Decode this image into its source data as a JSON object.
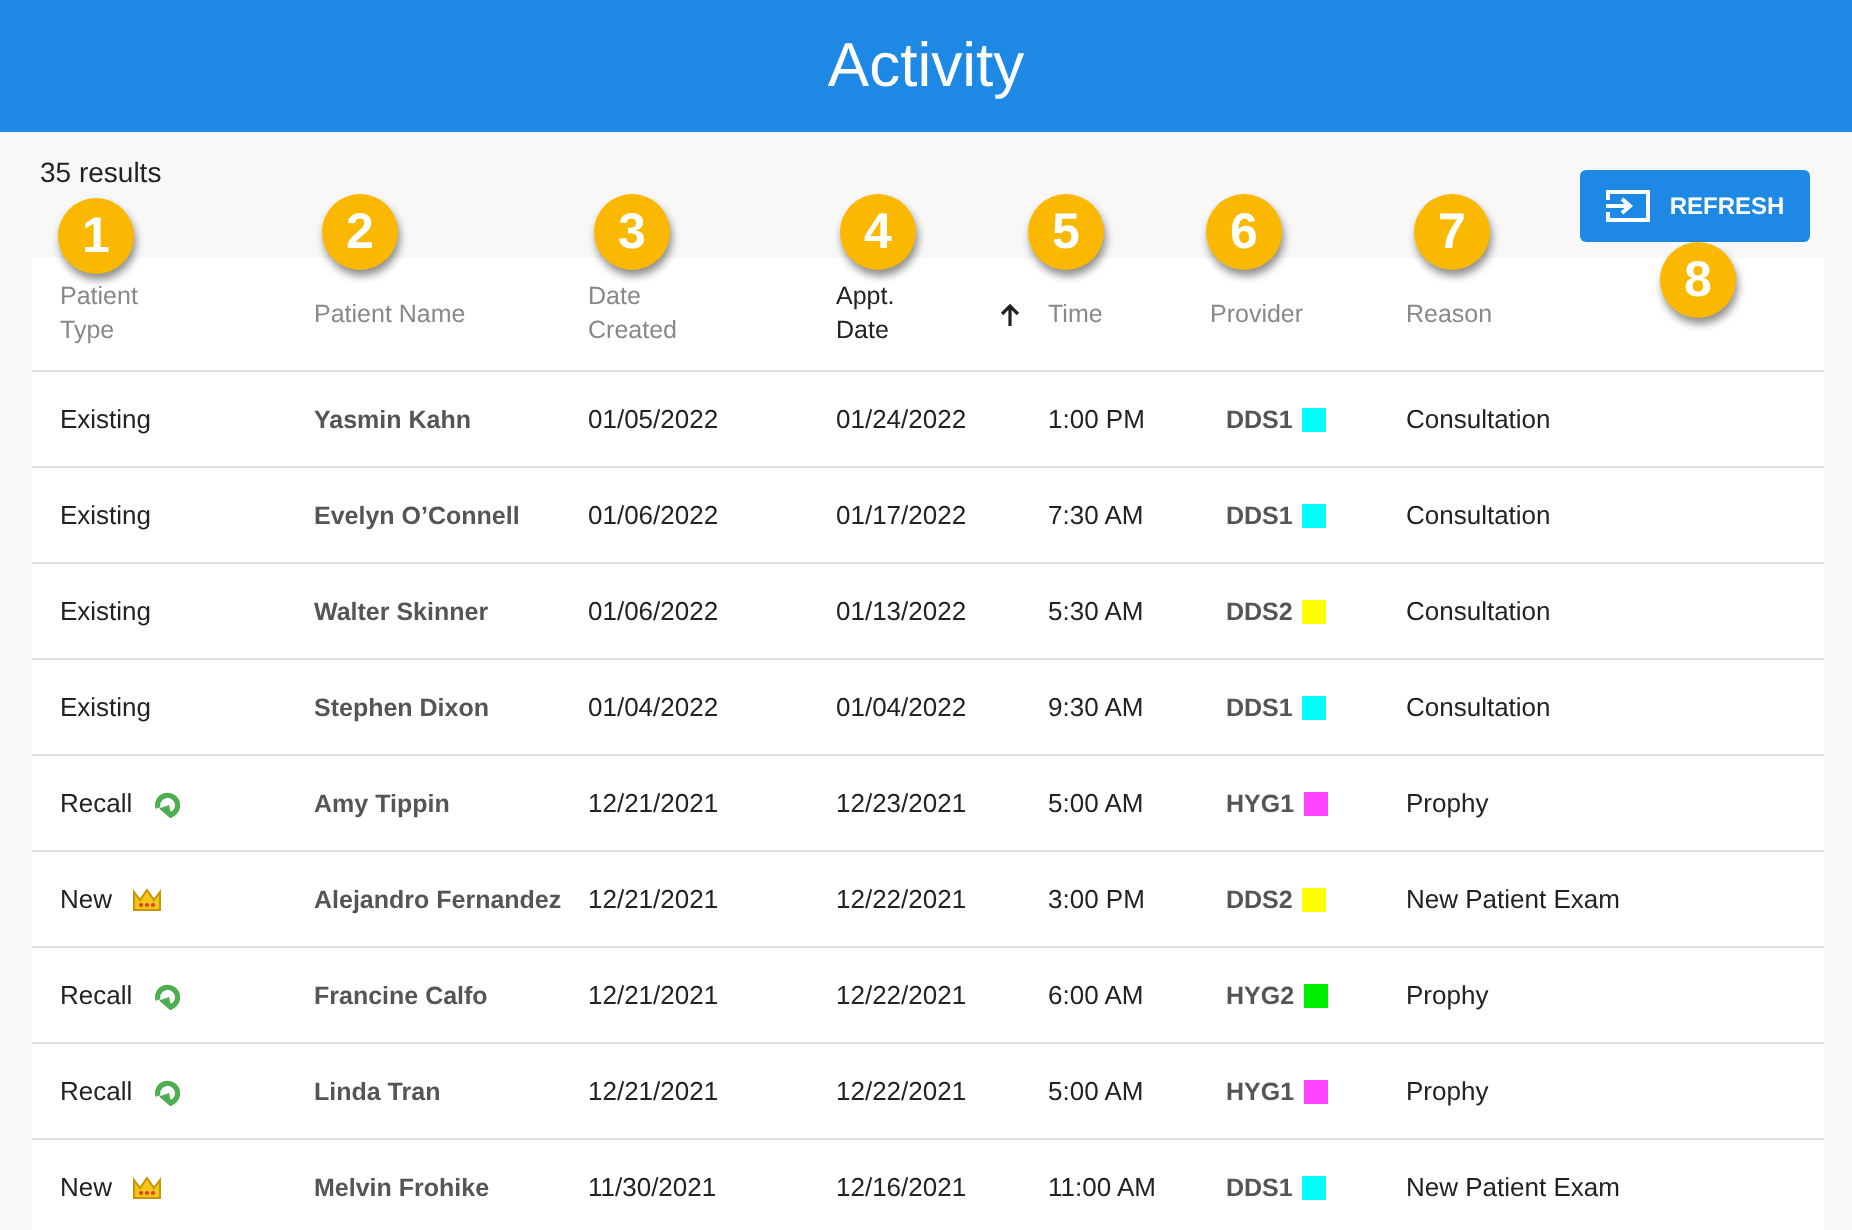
{
  "header": {
    "title": "Activity"
  },
  "results": "35 results",
  "refresh_button": "REFRESH",
  "columns": [
    {
      "label": "Patient\nType",
      "sorted": false
    },
    {
      "label": "Patient Name",
      "sorted": false
    },
    {
      "label": "Date\nCreated",
      "sorted": false
    },
    {
      "label": "Appt.\nDate",
      "sorted": true
    },
    {
      "label": "Time",
      "sorted": false
    },
    {
      "label": "Provider",
      "sorted": false
    },
    {
      "label": "Reason",
      "sorted": false
    }
  ],
  "rows": [
    {
      "type": "Existing",
      "kind": "existing",
      "name": "Yasmin Kahn",
      "created": "01/05/2022",
      "appt": "01/24/2022",
      "time": "1:00 PM",
      "provider": "DDS1",
      "color": "#00ffff",
      "reason": "Consultation"
    },
    {
      "type": "Existing",
      "kind": "existing",
      "name": "Evelyn O’Connell",
      "created": "01/06/2022",
      "appt": "01/17/2022",
      "time": "7:30 AM",
      "provider": "DDS1",
      "color": "#00ffff",
      "reason": "Consultation"
    },
    {
      "type": "Existing",
      "kind": "existing",
      "name": "Walter Skinner",
      "created": "01/06/2022",
      "appt": "01/13/2022",
      "time": "5:30 AM",
      "provider": "DDS2",
      "color": "#ffff00",
      "reason": "Consultation"
    },
    {
      "type": "Existing",
      "kind": "existing",
      "name": "Stephen Dixon",
      "created": "01/04/2022",
      "appt": "01/04/2022",
      "time": "9:30 AM",
      "provider": "DDS1",
      "color": "#00ffff",
      "reason": "Consultation"
    },
    {
      "type": "Recall",
      "kind": "recall",
      "name": "Amy Tippin",
      "created": "12/21/2021",
      "appt": "12/23/2021",
      "time": "5:00 AM",
      "provider": "HYG1",
      "color": "#ff44ff",
      "reason": "Prophy"
    },
    {
      "type": "New",
      "kind": "new",
      "name": "Alejandro Fernandez",
      "created": "12/21/2021",
      "appt": "12/22/2021",
      "time": "3:00 PM",
      "provider": "DDS2",
      "color": "#ffff00",
      "reason": "New Patient Exam"
    },
    {
      "type": "Recall",
      "kind": "recall",
      "name": "Francine Calfo",
      "created": "12/21/2021",
      "appt": "12/22/2021",
      "time": "6:00 AM",
      "provider": "HYG2",
      "color": "#00ee00",
      "reason": "Prophy"
    },
    {
      "type": "Recall",
      "kind": "recall",
      "name": "Linda Tran",
      "created": "12/21/2021",
      "appt": "12/22/2021",
      "time": "5:00 AM",
      "provider": "HYG1",
      "color": "#ff44ff",
      "reason": "Prophy"
    },
    {
      "type": "New",
      "kind": "new",
      "name": "Melvin Frohike",
      "created": "11/30/2021",
      "appt": "12/16/2021",
      "time": "11:00 AM",
      "provider": "DDS1",
      "color": "#00ffff",
      "reason": "New Patient Exam"
    }
  ],
  "callouts": [
    "1",
    "2",
    "3",
    "4",
    "5",
    "6",
    "7",
    "8"
  ]
}
